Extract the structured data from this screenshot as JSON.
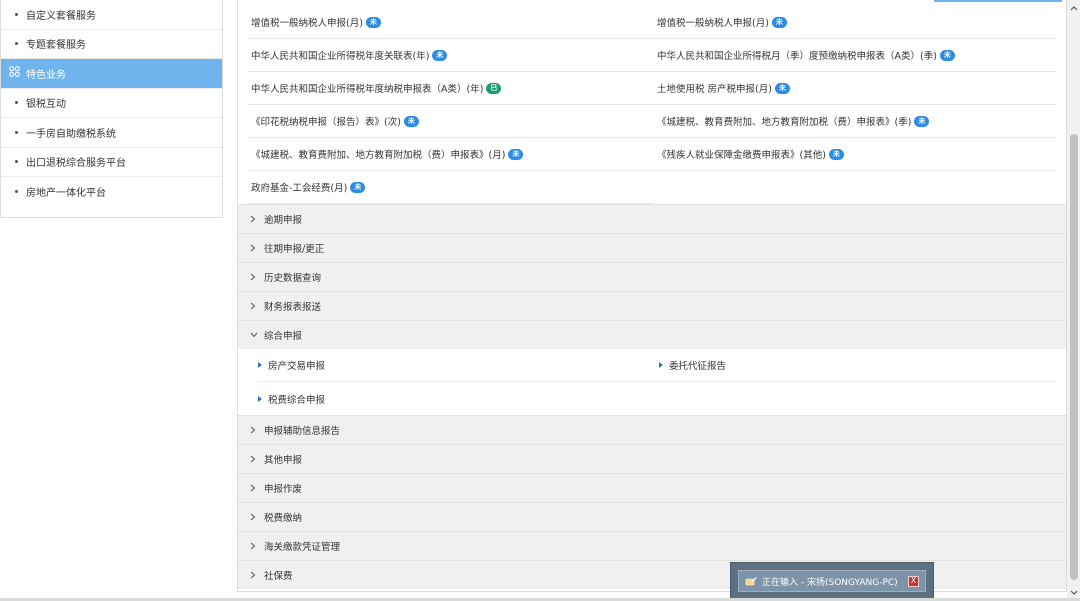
{
  "sidebar": {
    "items": [
      {
        "label": "自定义套餐服务",
        "active": false
      },
      {
        "label": "专题套餐服务",
        "active": false
      },
      {
        "label": "特色业务",
        "active": true
      },
      {
        "label": "银税互动",
        "active": false
      },
      {
        "label": "一手房自助缴税系统",
        "active": false
      },
      {
        "label": "出口退税综合服务平台",
        "active": false
      },
      {
        "label": "房地产一体化平台",
        "active": false
      }
    ]
  },
  "forms": {
    "rows": [
      [
        {
          "label": "增值税一般纳税人申报(月)",
          "badge": "未"
        },
        {
          "label": "增值税一般纳税人申报(月)",
          "badge": "未"
        }
      ],
      [
        {
          "label": "中华人民共和国企业所得税年度关联表(年)",
          "badge": "未"
        },
        {
          "label": "中华人民共和国企业所得税月（季）度预缴纳税申报表（A类）(季)",
          "badge": "未"
        }
      ],
      [
        {
          "label": "中华人民共和国企业所得税年度纳税申报表（A类）(年)",
          "badge": "已"
        },
        {
          "label": "土地使用税 房产税申报(月)",
          "badge": "未"
        }
      ],
      [
        {
          "label": "《印花税纳税申报（报告）表》(次)",
          "badge": "未"
        },
        {
          "label": "《城建税、教育费附加、地方教育附加税（费）申报表》(季)",
          "badge": "未"
        }
      ],
      [
        {
          "label": "《城建税、教育费附加、地方教育附加税（费）申报表》(月)",
          "badge": "未"
        },
        {
          "label": "《残疾人就业保障金缴费申报表》(其他)",
          "badge": "未"
        }
      ]
    ],
    "last_row": {
      "label": "政府基金-工会经费(月)",
      "badge": "未"
    }
  },
  "sections_before": [
    {
      "label": "逾期申报"
    },
    {
      "label": "往期申报/更正"
    },
    {
      "label": "历史数据查询"
    },
    {
      "label": "财务报表报送"
    }
  ],
  "expanded_section": {
    "label": "综合申报",
    "items": [
      [
        "房产交易申报",
        "委托代征报告"
      ],
      [
        "税费综合申报"
      ]
    ]
  },
  "sections_after": [
    {
      "label": "申报辅助信息报告"
    },
    {
      "label": "其他申报"
    },
    {
      "label": "申报作废"
    },
    {
      "label": "税费缴纳"
    },
    {
      "label": "海关缴款凭证管理"
    },
    {
      "label": "社保费"
    }
  ],
  "toast": {
    "text": "正在输入 - 宋扬(SONGYANG-PC)",
    "close_label": "X"
  },
  "colors": {
    "accent": "#6fb4ec",
    "badge_pending": "#2b8be6",
    "badge_done": "#1a9e6a"
  }
}
